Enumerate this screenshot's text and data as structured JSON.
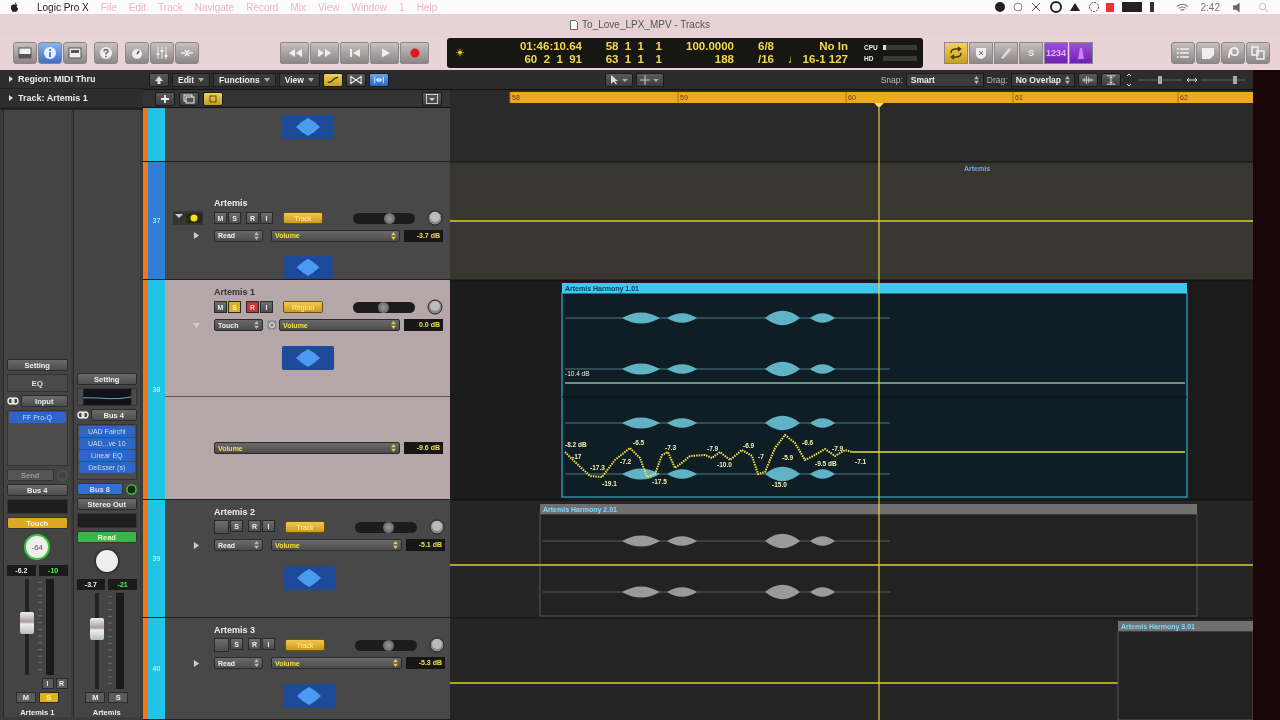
{
  "menu_bar": {
    "app": "Logic Pro X",
    "items": [
      "File",
      "Edit",
      "Track",
      "Navigate",
      "Record",
      "Mix",
      "View",
      "Window",
      "1",
      "Help"
    ],
    "clock": "2:42"
  },
  "window": {
    "title": "To_Love_LPX_MPV - Tracks"
  },
  "control_bar": {
    "view_buttons": [
      {
        "kind": "library",
        "selected": false
      },
      {
        "kind": "inspector",
        "selected": true
      },
      {
        "kind": "editors",
        "selected": false
      }
    ],
    "lcd": {
      "rows": [
        [
          "01:46:10.64",
          "58  1  1",
          "1",
          "100.0000",
          "6/8",
          "No In"
        ],
        [
          "60  2  1  91",
          "63  1  1",
          "1",
          "188",
          "/16",
          "♩ 16-1 127"
        ]
      ],
      "meters": [
        {
          "label": "CPU",
          "level": 0.1
        },
        {
          "label": "HD",
          "level": 0
        }
      ]
    },
    "mode_buttons": [
      {
        "kind": "cycle",
        "on": true
      },
      {
        "kind": "autopunch",
        "on": false
      },
      {
        "kind": "replace",
        "on": false
      },
      {
        "kind": "solo",
        "label": "S",
        "on": false
      },
      {
        "kind": "count_in",
        "label": "1234",
        "on": true
      },
      {
        "kind": "metronome",
        "on": true
      }
    ]
  },
  "inspector": {
    "region": "Region: MIDI Thru",
    "track": "Track: Artemis 1",
    "strips": [
      {
        "setting": "Setting",
        "eq": {
          "kind": "empty",
          "label": "EQ"
        },
        "input": "Input",
        "plugins": [
          "FF Pro-Q"
        ],
        "send": {
          "label": "Send",
          "active": false
        },
        "output": "Bus 4",
        "automation": {
          "label": "Touch",
          "color": "#e0a820"
        },
        "pan": {
          "label": "-64"
        },
        "readouts": [
          "-6.2",
          "-10"
        ],
        "fader": {
          "level": 0.55
        },
        "extra_buttons": [
          "I",
          "R"
        ],
        "mute": {
          "label": "M",
          "on": false
        },
        "solo": {
          "label": "S",
          "on": true
        },
        "name": "Artemis 1"
      },
      {
        "setting": "Setting",
        "eq": {
          "kind": "curve"
        },
        "input": "Bus 4",
        "plugins": [
          "UAD Fairchi",
          "UAD...ve 10",
          "Linear EQ",
          "DeEsser (s)"
        ],
        "send": {
          "label": "Bus 8",
          "active": true
        },
        "output": "Stereo Out",
        "automation": {
          "label": "Read",
          "color": "#3cb44a"
        },
        "readouts": [
          "-3.7",
          "-21"
        ],
        "fader": {
          "level": 0.63
        },
        "mute": {
          "label": "M",
          "on": false
        },
        "solo": {
          "label": "S",
          "on": false
        },
        "name": "Artemis"
      }
    ]
  },
  "tracks_toolbar": {
    "menus": [
      "Edit",
      "Functions",
      "View"
    ],
    "snap_label": "Snap:",
    "snap": "Smart",
    "drag_label": "Drag:",
    "drag": "No Overlap"
  },
  "ruler": [
    "58",
    "59",
    "60",
    "61",
    "62"
  ],
  "tracks": [
    {
      "kind": "partial",
      "color": "#22c4e6"
    },
    {
      "kind": "folder",
      "color": "#2f7fd8",
      "number": "37",
      "name": "Artemis",
      "selected": false,
      "expanded": false,
      "buttons": [
        {
          "label": "M",
          "on": false
        },
        {
          "label": "S",
          "on": false
        },
        {
          "label": "R",
          "on": false
        },
        {
          "label": "I",
          "on": false
        }
      ],
      "group": "Track",
      "level": 0.6,
      "mode": "Read",
      "parameter": "Volume",
      "value": "-3.7 dB"
    },
    {
      "kind": "audio",
      "color": "#22c4e6",
      "number": "38",
      "name": "Artemis 1",
      "selected": true,
      "expanded": true,
      "buttons": [
        {
          "label": "M",
          "on": false
        },
        {
          "label": "S",
          "on": true
        },
        {
          "label": "R",
          "on": true
        },
        {
          "label": "I",
          "on": false
        }
      ],
      "group": "Region",
      "level": 0.5,
      "mode": "Touch",
      "parameter": "Volume",
      "value": "0.0 dB",
      "lane": {
        "parameter": "Volume",
        "value": "-9.6 dB"
      }
    },
    {
      "kind": "audio",
      "color": "#22c4e6",
      "number": "39",
      "name": "Artemis 2",
      "selected": false,
      "expanded": false,
      "buttons": [
        {
          "label": "S",
          "on": false
        },
        {
          "label": "R",
          "on": false
        },
        {
          "label": "I",
          "on": false
        }
      ],
      "group": "Track",
      "level": 0.55,
      "mode": "Read",
      "parameter": "Volume",
      "value": "-5.1 dB"
    },
    {
      "kind": "audio",
      "color": "#22c4e6",
      "number": "40",
      "name": "Artemis 3",
      "selected": false,
      "expanded": false,
      "buttons": [
        {
          "label": "S",
          "on": false
        },
        {
          "label": "R",
          "on": false
        },
        {
          "label": "I",
          "on": false
        }
      ],
      "group": "Track",
      "level": 0.55,
      "mode": "Read",
      "parameter": "Volume",
      "value": "-5.3 dB"
    }
  ],
  "arrange": {
    "folder_label": "Artemis",
    "regions": [
      {
        "name": "Artemis Harmony 1.01",
        "selected": true
      },
      {
        "name": "Artemis Harmony 2.01",
        "selected": false
      },
      {
        "name": "Artemis Harmony 3.01",
        "selected": false
      }
    ],
    "volume_label": "-10.4 dB",
    "automation_labels": [
      "-8.2 dB",
      "-17",
      "-17.3",
      "-19.1",
      "-6.5",
      "-7.2",
      "-17.5",
      "-7.3",
      "-7.9",
      "-10.0",
      "-6.9",
      "-7",
      "-15.0",
      "-5.9",
      "-6.6",
      "-9.5 dB",
      "-7.9",
      "-7.1"
    ]
  }
}
